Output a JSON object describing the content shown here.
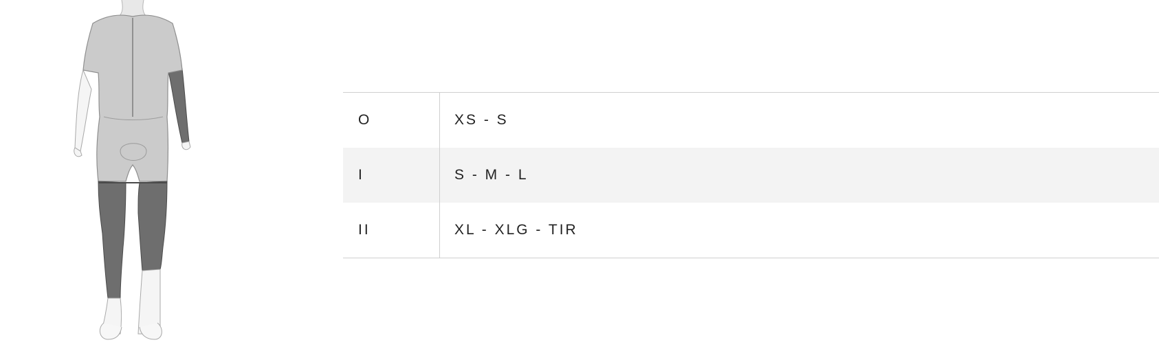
{
  "size_chart": {
    "rows": [
      {
        "code": "O",
        "sizes": "XS - S"
      },
      {
        "code": "I",
        "sizes": "S - M - L"
      },
      {
        "code": "II",
        "sizes": "XL - XLG - TIR"
      }
    ]
  },
  "colors": {
    "garment_light": "#cbcbcb",
    "garment_dark": "#6e6e6e",
    "outline": "#9a9a9a",
    "row_alt": "#f3f3f3",
    "border": "#cfcfcf"
  }
}
